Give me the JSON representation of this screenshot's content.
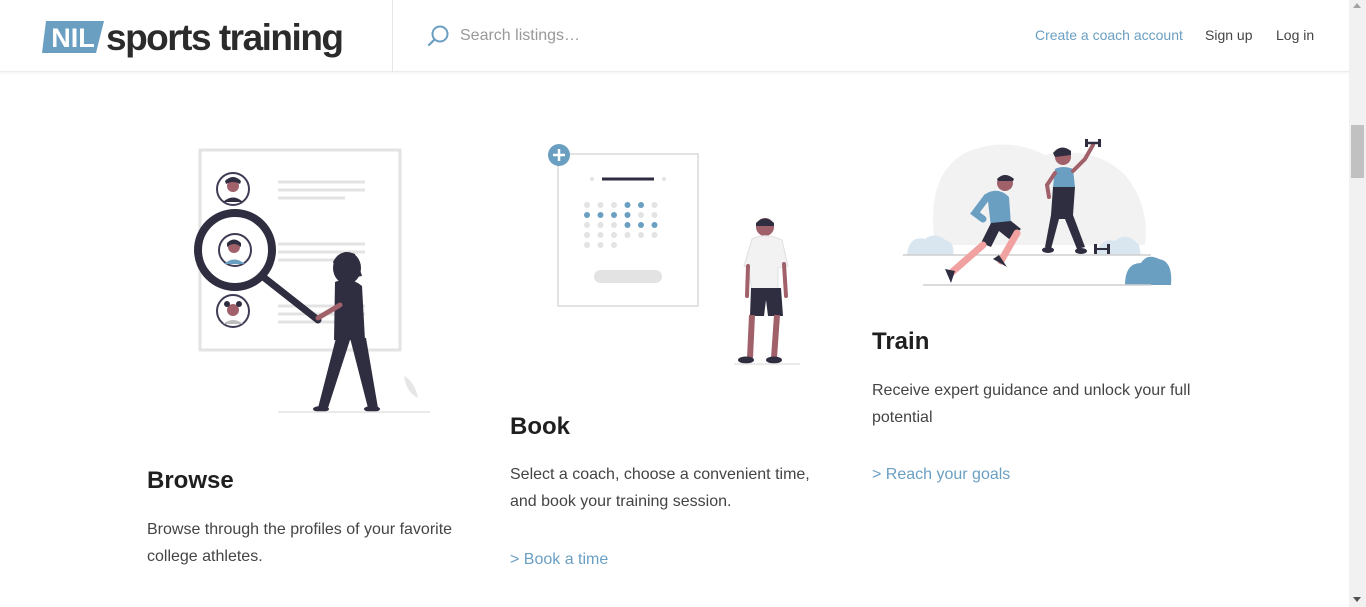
{
  "header": {
    "logo_badge": "NIL",
    "logo_text": "sports training",
    "search_placeholder": "Search listings…",
    "nav": {
      "create_coach": "Create a coach account",
      "signup": "Sign up",
      "login": "Log in"
    }
  },
  "columns": [
    {
      "title": "Browse",
      "description": "Browse through the profiles of your favorite college athletes.",
      "link": ""
    },
    {
      "title": "Book",
      "description": "Select a coach, choose a convenient time, and book your training session.",
      "link": "> Book a time"
    },
    {
      "title": "Train",
      "description": "Receive expert guidance and unlock your full potential",
      "link": "> Reach your goals"
    }
  ],
  "colors": {
    "accent": "#6a9fc2",
    "dark": "#2f2e41",
    "skin": "#a0616a"
  },
  "icons": [
    "search-icon",
    "plus-icon"
  ]
}
